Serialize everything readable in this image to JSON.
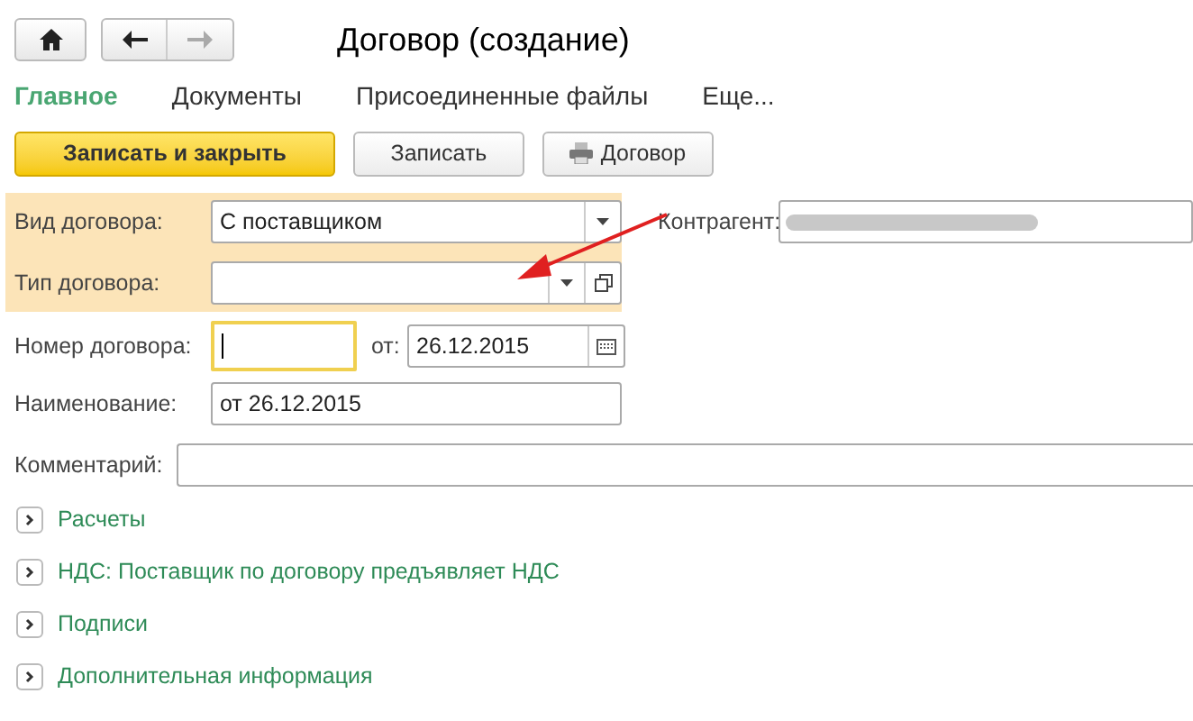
{
  "window": {
    "title": "Договор (создание)"
  },
  "tabs": [
    {
      "label": "Главное",
      "selected": true
    },
    {
      "label": "Документы",
      "selected": false
    },
    {
      "label": "Присоединенные файлы",
      "selected": false
    },
    {
      "label": "Еще...",
      "selected": false
    }
  ],
  "toolbar": {
    "primary": "Записать и закрыть",
    "save": "Записать",
    "print": "Договор"
  },
  "form": {
    "contract_kind": {
      "label": "Вид договора:",
      "value": "С поставщиком"
    },
    "counterparty": {
      "label": "Контрагент:"
    },
    "contract_type": {
      "label": "Тип договора:"
    },
    "number": {
      "label": "Номер договора:",
      "focused": true,
      "date_label": "от:",
      "date": "26.12.2015"
    },
    "name": {
      "label": "Наименование:",
      "value": "от 26.12.2015"
    },
    "comment": {
      "label": "Комментарий:"
    }
  },
  "sections": [
    {
      "title": "Расчеты",
      "expanded": false
    },
    {
      "title": "НДС: Поставщик по договору предъявляет НДС",
      "expanded": false
    },
    {
      "title": "Подписи",
      "expanded": false
    },
    {
      "title": "Дополнительная информация",
      "expanded": false
    }
  ]
}
